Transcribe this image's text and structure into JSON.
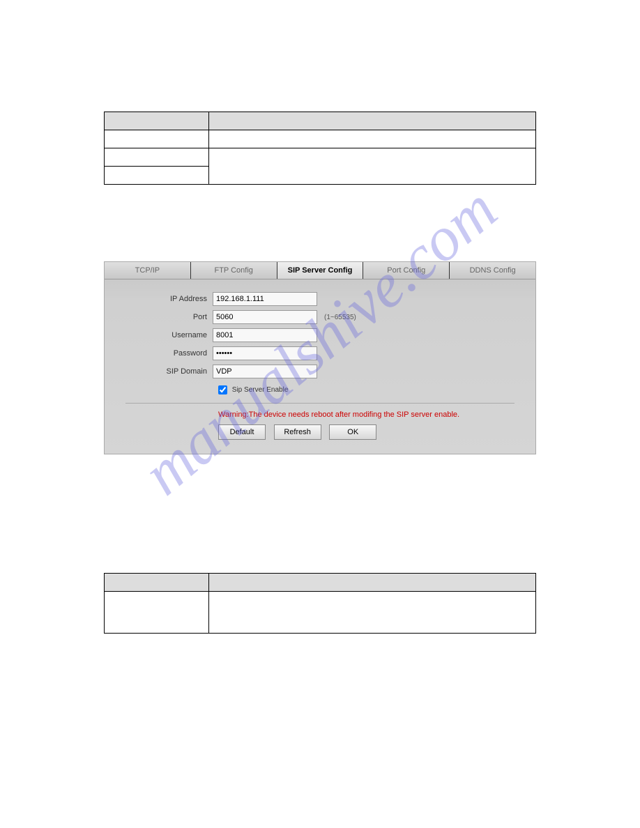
{
  "watermark": "manualshive.com",
  "table1": {
    "rows": [
      [
        "",
        ""
      ],
      [
        "",
        ""
      ],
      [
        "",
        ""
      ],
      [
        "",
        ""
      ]
    ]
  },
  "sip": {
    "tabs": [
      "TCP/IP",
      "FTP Config",
      "SIP Server Config",
      "Port Config",
      "DDNS Config"
    ],
    "activeTab": 2,
    "fields": {
      "ip_label": "IP Address",
      "ip_value": "192.168.1.111",
      "port_label": "Port",
      "port_value": "5060",
      "port_hint": "(1~65535)",
      "user_label": "Username",
      "user_value": "8001",
      "pass_label": "Password",
      "pass_value": "••••••",
      "domain_label": "SIP Domain",
      "domain_value": "VDP",
      "enable_label": "Sip Server Enable"
    },
    "warning": "Warning:The device needs reboot after modifing the SIP server enable.",
    "buttons": {
      "default": "Default",
      "refresh": "Refresh",
      "ok": "OK"
    }
  },
  "table2": {
    "rows": [
      [
        "",
        ""
      ],
      [
        "",
        ""
      ]
    ]
  }
}
